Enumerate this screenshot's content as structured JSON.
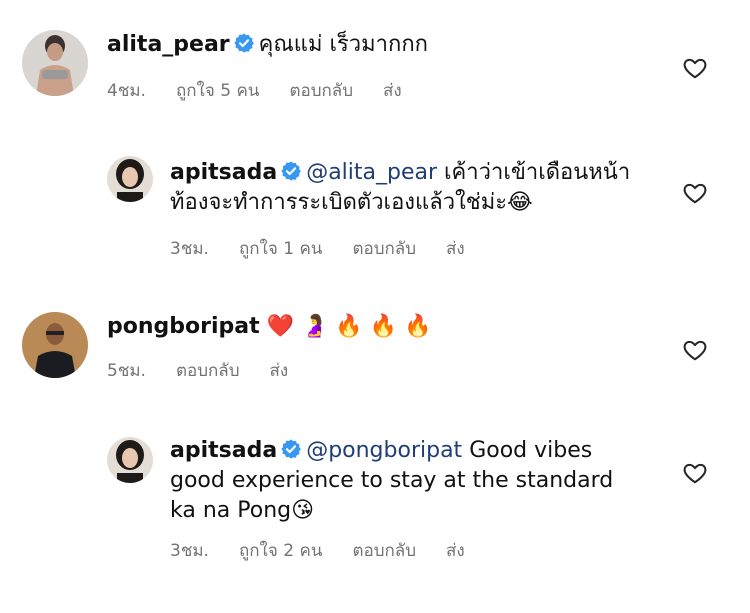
{
  "comments": [
    {
      "username": "alita_pear",
      "text": "คุณแม่ เร็วมากกก",
      "time": "4ชม.",
      "likes": "ถูกใจ 5 คน",
      "reply": "ตอบกลับ",
      "send": "ส่ง"
    },
    {
      "username": "apitsada",
      "mention": "@alita_pear",
      "text_line1": "เค้าว่าเข้าเดือนหน้า",
      "text_line2": "ท้องจะทำการระเบิดตัวเองแล้วใช่ม่ะ",
      "emoji": "😂",
      "time": "3ชม.",
      "likes": "ถูกใจ 1 คน",
      "reply": "ตอบกลับ",
      "send": "ส่ง"
    },
    {
      "username": "pongboripat",
      "emojis": "❤️ 🤰 🔥 🔥 🔥",
      "time": "5ชม.",
      "reply": "ตอบกลับ",
      "send": "ส่ง"
    },
    {
      "username": "apitsada",
      "mention": "@pongboripat",
      "text_line1": "Good vibes",
      "text_line2": "good experience to stay at the standard",
      "text_line3": "ka na Pong",
      "emoji": "😘",
      "time": "3ชม.",
      "likes": "ถูกใจ 2 คน",
      "reply": "ตอบกลับ",
      "send": "ส่ง"
    }
  ],
  "colors": {
    "verified": "#3897f0",
    "mention": "#1f3e77",
    "meta": "#737373"
  }
}
